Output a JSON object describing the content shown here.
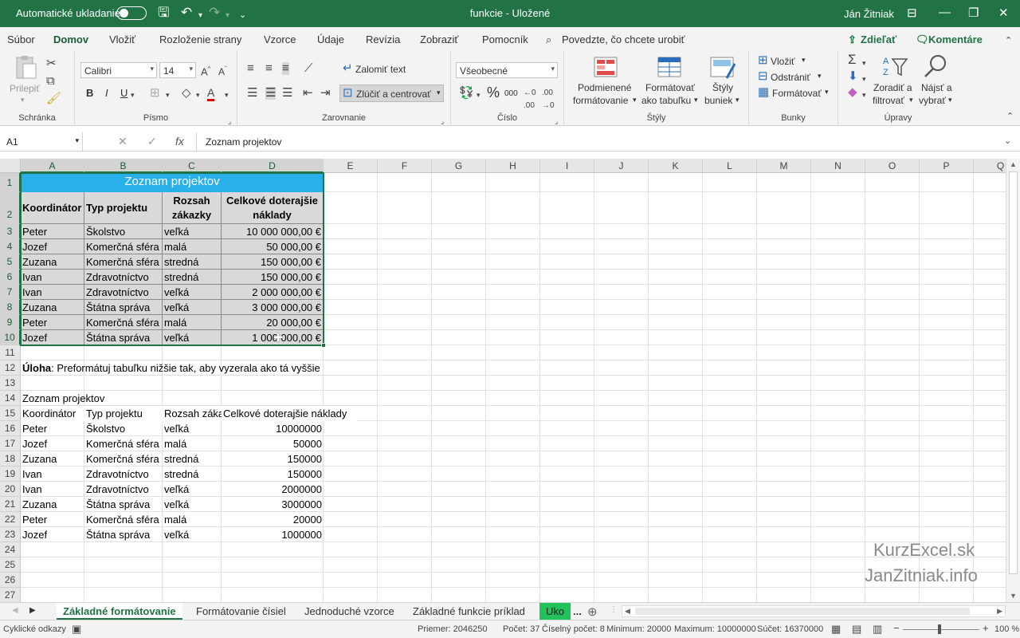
{
  "titlebar": {
    "autosave": "Automatické ukladanie",
    "title": "funkcie  -  Uložené",
    "user": "Ján Žitniak"
  },
  "menu": {
    "items": [
      "Súbor",
      "Domov",
      "Vložiť",
      "Rozloženie strany",
      "Vzorce",
      "Údaje",
      "Revízia",
      "Zobraziť",
      "Pomocník"
    ],
    "tell": "Povedzte, čo chcete urobiť",
    "share": "Zdieľať",
    "comments": "Komentáre"
  },
  "ribbon": {
    "clipboard": {
      "paste": "Prilepiť",
      "label": "Schránka"
    },
    "font": {
      "name": "Calibri",
      "size": "14",
      "bold": "B",
      "italic": "I",
      "underline": "U",
      "label": "Písmo"
    },
    "alignment": {
      "wrap": "Zalomiť text",
      "merge": "Zlúčiť a centrovať",
      "label": "Zarovnanie"
    },
    "number": {
      "format": "Všeobecné",
      "percent": "%",
      "thousands": "000",
      "label": "Číslo"
    },
    "styles": {
      "conditional1": "Podmienené",
      "conditional2": "formátovanie",
      "table1": "Formátovať",
      "table2": "ako tabuľku",
      "cell1": "Štýly",
      "cell2": "buniek",
      "label": "Štýly"
    },
    "cells": {
      "insert": "Vložiť",
      "delete": "Odstrániť",
      "format": "Formátovať",
      "label": "Bunky"
    },
    "editing": {
      "sort1": "Zoradiť a",
      "sort2": "filtrovať",
      "find1": "Nájsť a",
      "find2": "vybrať",
      "label": "Úpravy"
    }
  },
  "formula_bar": {
    "name_box": "A1",
    "fx": "fx",
    "content": "Zoznam projektov"
  },
  "columns": [
    "A",
    "B",
    "C",
    "D",
    "E",
    "F",
    "G",
    "H",
    "I",
    "J",
    "K",
    "L",
    "M",
    "N",
    "O",
    "P",
    "Q"
  ],
  "rows": [
    "1",
    "2",
    "3",
    "4",
    "5",
    "6",
    "7",
    "8",
    "9",
    "10",
    "11",
    "12",
    "13",
    "14",
    "15",
    "16",
    "17",
    "18",
    "19",
    "20",
    "21",
    "22",
    "23",
    "24",
    "25",
    "26",
    "27"
  ],
  "formatted_table": {
    "title": "Zoznam projektov",
    "headers": [
      "Koordinátor",
      "Typ projektu",
      "Rozsah zákazky",
      "Celkové doterajšie náklady"
    ],
    "rows": [
      [
        "Peter",
        "Školstvo",
        "veľká",
        "10 000 000,00 €"
      ],
      [
        "Jozef",
        "Komerčná sféra",
        "malá",
        "50 000,00 €"
      ],
      [
        "Zuzana",
        "Komerčná sféra",
        "stredná",
        "150 000,00 €"
      ],
      [
        "Ivan",
        "Zdravotníctvo",
        "stredná",
        "150 000,00 €"
      ],
      [
        "Ivan",
        "Zdravotníctvo",
        "veľká",
        "2 000 000,00 €"
      ],
      [
        "Zuzana",
        "Štátna správa",
        "veľká",
        "3 000 000,00 €"
      ],
      [
        "Peter",
        "Komerčná sféra",
        "malá",
        "20 000,00 €"
      ],
      [
        "Jozef",
        "Štátna správa",
        "veľká",
        "1 000 000,00 €"
      ]
    ]
  },
  "task": {
    "bold": "Úloha",
    "text": ": Preformátuj tabuľku nižšie tak, aby vyzerala ako tá vyššie"
  },
  "raw_table": {
    "title": "Zoznam projektov",
    "headers": [
      "Koordinátor",
      "Typ projektu",
      "Rozsah zákazky",
      "Celkové doterajšie náklady"
    ],
    "rows": [
      [
        "Peter",
        "Školstvo",
        "veľká",
        "10000000"
      ],
      [
        "Jozef",
        "Komerčná sféra",
        "malá",
        "50000"
      ],
      [
        "Zuzana",
        "Komerčná sféra",
        "stredná",
        "150000"
      ],
      [
        "Ivan",
        "Zdravotníctvo",
        "stredná",
        "150000"
      ],
      [
        "Ivan",
        "Zdravotníctvo",
        "veľká",
        "2000000"
      ],
      [
        "Zuzana",
        "Štátna správa",
        "veľká",
        "3000000"
      ],
      [
        "Peter",
        "Komerčná sféra",
        "malá",
        "20000"
      ],
      [
        "Jozef",
        "Štátna správa",
        "veľká",
        "1000000"
      ]
    ]
  },
  "watermark": {
    "line1": "KurzExcel.sk",
    "line2": "JanZitniak.info"
  },
  "tabs": [
    "Základné formátovanie",
    "Formátovanie čísiel",
    "Jednoduché vzorce",
    "Základné funkcie príklad",
    "Uko"
  ],
  "tabs_more": "...",
  "status": {
    "mode": "Cyklické odkazy",
    "average": "Priemer: 2046250",
    "count": "Počet: 37",
    "numcount": "Číselný počet: 8",
    "min": "Minimum: 20000",
    "max": "Maximum: 10000000",
    "sum": "Súčet: 16370000",
    "zoom": "100 %",
    "zoom_minus": "−",
    "zoom_plus": "+"
  },
  "colors": {
    "accent": "#217346",
    "title_fill": "#2ab0e8",
    "table_fill": "#d9d9d9",
    "active_tab": "#21c25a"
  }
}
